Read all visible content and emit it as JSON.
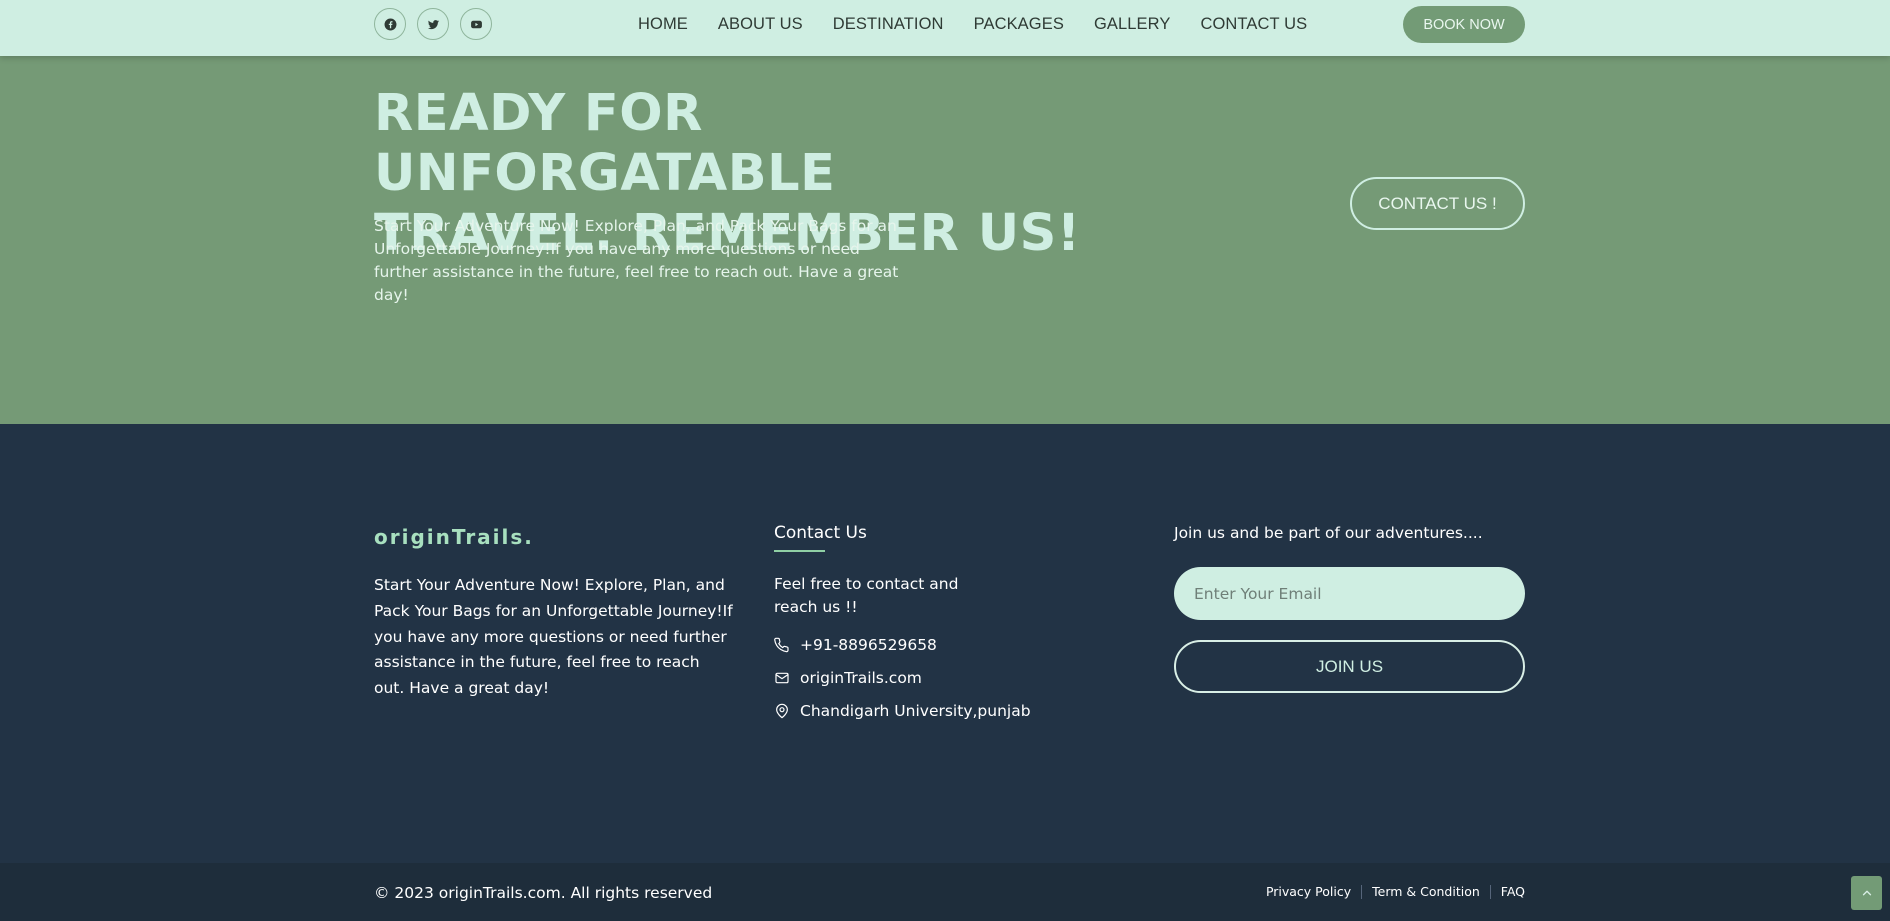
{
  "navbar": {
    "social": [
      {
        "icon": "facebook-icon"
      },
      {
        "icon": "twitter-icon"
      },
      {
        "icon": "youtube-icon"
      }
    ],
    "links": [
      "HOME",
      "ABOUT US",
      "DESTINATION",
      "PACKAGES",
      "GALLERY",
      "CONTACT US"
    ],
    "book_label": "BOOK NOW"
  },
  "hero": {
    "title_line1": "READY FOR UNFORGATABLE",
    "title_line2": "TRAVEL. REMEMBER US!",
    "text": "Start Your Adventure Now! Explore, Plan, and Pack Your Bags for an Unforgettable Journey!If you have any more questions or need further assistance in the future, feel free to reach out. Have a great day!",
    "contact_label": "CONTACT US !"
  },
  "footer": {
    "brand": "originTrails.",
    "about": "Start Your Adventure Now! Explore, Plan, and Pack Your Bags for an Unforgettable Journey!If you have any more questions or need further assistance in the future, feel free to reach out. Have a great day!",
    "contact": {
      "title": "Contact Us",
      "intro": "Feel free to contact and reach us !!",
      "phone": "+91-8896529658",
      "email": "originTrails.com",
      "address": "Chandigarh University,punjab"
    },
    "newsletter": {
      "text": "Join us and be part of our adventures....",
      "placeholder": "Enter Your Email",
      "button_label": "JOIN US"
    }
  },
  "bottombar": {
    "copyright": "© 2023 originTrails.com. All rights reserved",
    "links": [
      "Privacy Policy",
      "Term & Condition",
      "FAQ"
    ]
  },
  "colors": {
    "nav_bg": "#cfeee2",
    "hero_bg": "#759a76",
    "footer_bg": "#223345",
    "accent": "#739b76"
  }
}
